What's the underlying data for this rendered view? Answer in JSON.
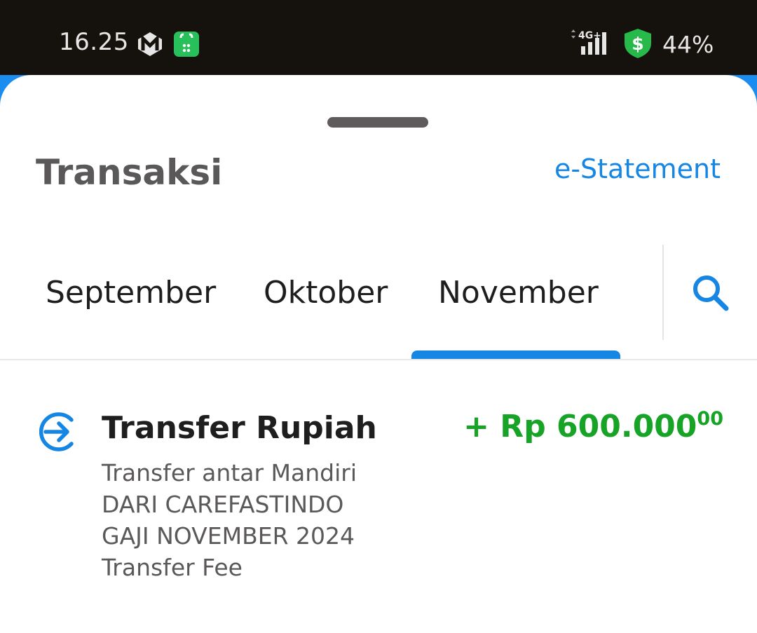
{
  "status_bar": {
    "time": "16.25",
    "network": "4G+",
    "battery": "44%"
  },
  "sheet": {
    "title": "Transaksi",
    "estatement_label": "e-Statement"
  },
  "tabs": [
    {
      "label": "September",
      "active": false
    },
    {
      "label": "Oktober",
      "active": false
    },
    {
      "label": "November",
      "active": true
    }
  ],
  "transaction": {
    "title": "Transfer Rupiah",
    "amount": "+ Rp 600.000",
    "amount_cents": "00",
    "amount_color": "#17a325",
    "details": [
      "Transfer antar Mandiri",
      "DARI CAREFASTINDO",
      "GAJI NOVEMBER 2024",
      "Transfer Fee"
    ],
    "icon": "transfer-in-icon"
  },
  "colors": {
    "accent": "#1586e3",
    "status_bar_bg": "#15110d"
  }
}
